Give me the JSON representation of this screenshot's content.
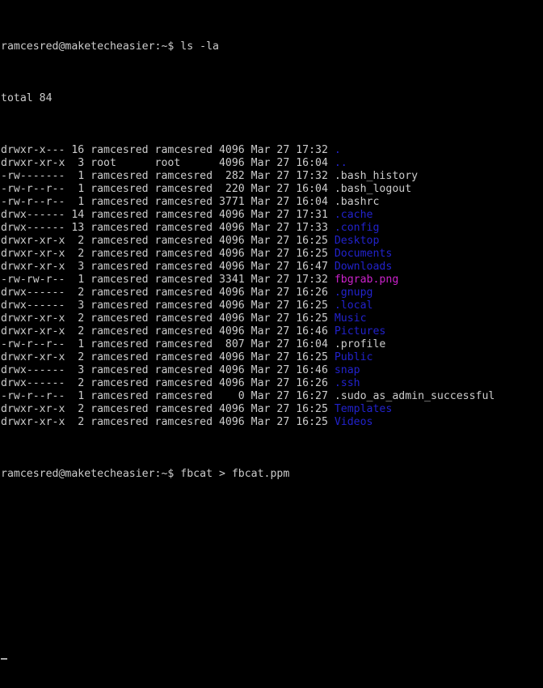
{
  "terminal": {
    "colors": {
      "background": "#000000",
      "foreground": "#cccccc",
      "directory": "#2222cc",
      "image_file": "#cc22cc",
      "cursor": "#aaaaaa"
    },
    "prompt": "ramcesred@maketecheasier:~$",
    "user": "ramcesred",
    "host": "maketecheasier",
    "cwd": "~"
  },
  "commands": {
    "first": {
      "prompt": "ramcesred@maketecheasier:~$",
      "command": "ls -la",
      "full_line": "ramcesred@maketecheasier:~$ ls -la"
    },
    "second": {
      "prompt": "ramcesred@maketecheasier:~$",
      "command": "fbcat > fbcat.ppm",
      "full_line": "ramcesred@maketecheasier:~$ fbcat > fbcat.ppm"
    }
  },
  "listing": {
    "total_line": "total 84",
    "total_blocks": "84",
    "rows": [
      {
        "perms": "drwxr-x---",
        "links": "16",
        "owner": "ramcesred",
        "group": "ramcesred",
        "size": "4096",
        "month": "Mar",
        "day": "27",
        "time": "17:32",
        "name": ".",
        "type": "dir"
      },
      {
        "perms": "drwxr-xr-x",
        "links": "3",
        "owner": "root",
        "group": "root",
        "size": "4096",
        "month": "Mar",
        "day": "27",
        "time": "16:04",
        "name": "..",
        "type": "dir"
      },
      {
        "perms": "-rw-------",
        "links": "1",
        "owner": "ramcesred",
        "group": "ramcesred",
        "size": "282",
        "month": "Mar",
        "day": "27",
        "time": "17:32",
        "name": ".bash_history",
        "type": "file"
      },
      {
        "perms": "-rw-r--r--",
        "links": "1",
        "owner": "ramcesred",
        "group": "ramcesred",
        "size": "220",
        "month": "Mar",
        "day": "27",
        "time": "16:04",
        "name": ".bash_logout",
        "type": "file"
      },
      {
        "perms": "-rw-r--r--",
        "links": "1",
        "owner": "ramcesred",
        "group": "ramcesred",
        "size": "3771",
        "month": "Mar",
        "day": "27",
        "time": "16:04",
        "name": ".bashrc",
        "type": "file"
      },
      {
        "perms": "drwx------",
        "links": "14",
        "owner": "ramcesred",
        "group": "ramcesred",
        "size": "4096",
        "month": "Mar",
        "day": "27",
        "time": "17:31",
        "name": ".cache",
        "type": "dir"
      },
      {
        "perms": "drwx------",
        "links": "13",
        "owner": "ramcesred",
        "group": "ramcesred",
        "size": "4096",
        "month": "Mar",
        "day": "27",
        "time": "17:33",
        "name": ".config",
        "type": "dir"
      },
      {
        "perms": "drwxr-xr-x",
        "links": "2",
        "owner": "ramcesred",
        "group": "ramcesred",
        "size": "4096",
        "month": "Mar",
        "day": "27",
        "time": "16:25",
        "name": "Desktop",
        "type": "dir"
      },
      {
        "perms": "drwxr-xr-x",
        "links": "2",
        "owner": "ramcesred",
        "group": "ramcesred",
        "size": "4096",
        "month": "Mar",
        "day": "27",
        "time": "16:25",
        "name": "Documents",
        "type": "dir"
      },
      {
        "perms": "drwxr-xr-x",
        "links": "3",
        "owner": "ramcesred",
        "group": "ramcesred",
        "size": "4096",
        "month": "Mar",
        "day": "27",
        "time": "16:47",
        "name": "Downloads",
        "type": "dir"
      },
      {
        "perms": "-rw-rw-r--",
        "links": "1",
        "owner": "ramcesred",
        "group": "ramcesred",
        "size": "3341",
        "month": "Mar",
        "day": "27",
        "time": "17:32",
        "name": "fbgrab.png",
        "type": "image"
      },
      {
        "perms": "drwx------",
        "links": "2",
        "owner": "ramcesred",
        "group": "ramcesred",
        "size": "4096",
        "month": "Mar",
        "day": "27",
        "time": "16:26",
        "name": ".gnupg",
        "type": "dir"
      },
      {
        "perms": "drwx------",
        "links": "3",
        "owner": "ramcesred",
        "group": "ramcesred",
        "size": "4096",
        "month": "Mar",
        "day": "27",
        "time": "16:25",
        "name": ".local",
        "type": "dir"
      },
      {
        "perms": "drwxr-xr-x",
        "links": "2",
        "owner": "ramcesred",
        "group": "ramcesred",
        "size": "4096",
        "month": "Mar",
        "day": "27",
        "time": "16:25",
        "name": "Music",
        "type": "dir"
      },
      {
        "perms": "drwxr-xr-x",
        "links": "2",
        "owner": "ramcesred",
        "group": "ramcesred",
        "size": "4096",
        "month": "Mar",
        "day": "27",
        "time": "16:46",
        "name": "Pictures",
        "type": "dir"
      },
      {
        "perms": "-rw-r--r--",
        "links": "1",
        "owner": "ramcesred",
        "group": "ramcesred",
        "size": "807",
        "month": "Mar",
        "day": "27",
        "time": "16:04",
        "name": ".profile",
        "type": "file"
      },
      {
        "perms": "drwxr-xr-x",
        "links": "2",
        "owner": "ramcesred",
        "group": "ramcesred",
        "size": "4096",
        "month": "Mar",
        "day": "27",
        "time": "16:25",
        "name": "Public",
        "type": "dir"
      },
      {
        "perms": "drwx------",
        "links": "3",
        "owner": "ramcesred",
        "group": "ramcesred",
        "size": "4096",
        "month": "Mar",
        "day": "27",
        "time": "16:46",
        "name": "snap",
        "type": "dir"
      },
      {
        "perms": "drwx------",
        "links": "2",
        "owner": "ramcesred",
        "group": "ramcesred",
        "size": "4096",
        "month": "Mar",
        "day": "27",
        "time": "16:26",
        "name": ".ssh",
        "type": "dir"
      },
      {
        "perms": "-rw-r--r--",
        "links": "1",
        "owner": "ramcesred",
        "group": "ramcesred",
        "size": "0",
        "month": "Mar",
        "day": "27",
        "time": "16:27",
        "name": ".sudo_as_admin_successful",
        "type": "file"
      },
      {
        "perms": "drwxr-xr-x",
        "links": "2",
        "owner": "ramcesred",
        "group": "ramcesred",
        "size": "4096",
        "month": "Mar",
        "day": "27",
        "time": "16:25",
        "name": "Templates",
        "type": "dir"
      },
      {
        "perms": "drwxr-xr-x",
        "links": "2",
        "owner": "ramcesred",
        "group": "ramcesred",
        "size": "4096",
        "month": "Mar",
        "day": "27",
        "time": "16:25",
        "name": "Videos",
        "type": "dir"
      }
    ]
  },
  "cursor": {
    "glyph": "_",
    "visible": true
  }
}
